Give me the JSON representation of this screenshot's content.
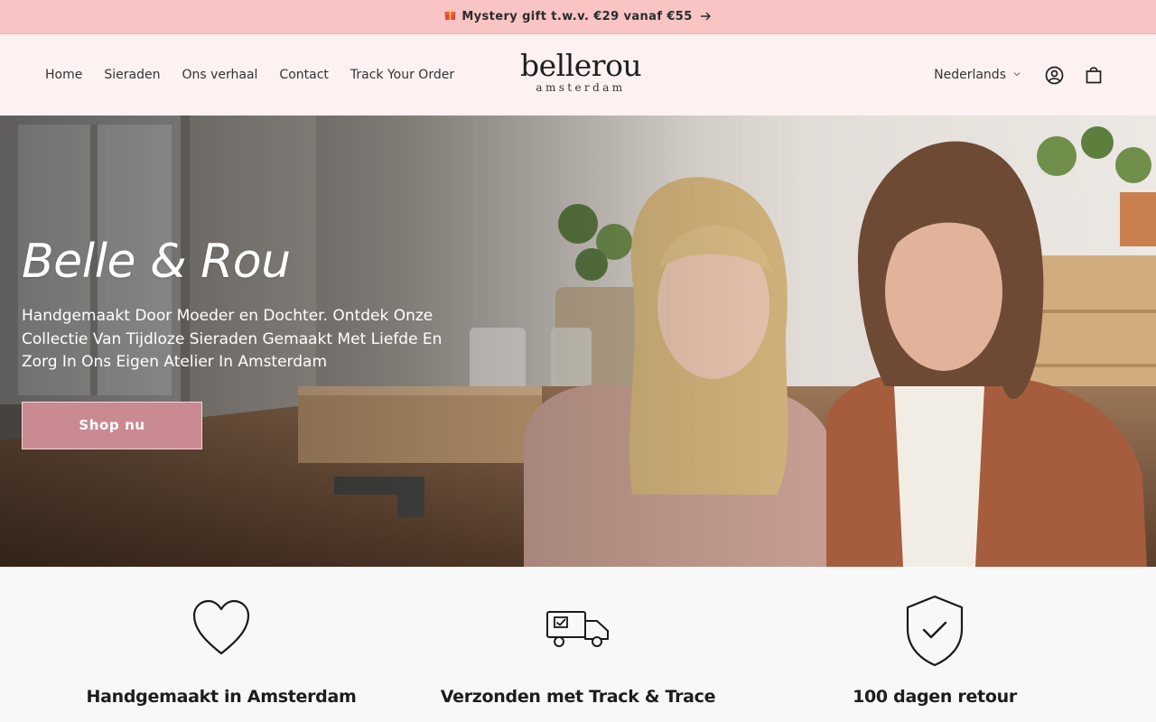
{
  "announcement": {
    "gift_icon": "gift-icon",
    "text": "Mystery gift t.w.v. €29 vanaf €55",
    "arrow_icon": "arrow-right-icon"
  },
  "nav": {
    "items": [
      {
        "label": "Home"
      },
      {
        "label": "Sieraden"
      },
      {
        "label": "Ons verhaal"
      },
      {
        "label": "Contact"
      },
      {
        "label": "Track Your Order"
      }
    ]
  },
  "logo": {
    "word": "bellerou",
    "sub": "amsterdam"
  },
  "header_right": {
    "language": "Nederlands",
    "account_icon": "account-icon",
    "cart_icon": "shopping-bag-icon"
  },
  "hero": {
    "title": "Belle & Rou",
    "description": "Handgemaakt Door Moeder en Dochter. Ontdek Onze Collectie Van Tijdloze Sieraden Gemaakt Met Liefde En Zorg In Ons Eigen Atelier In Amsterdam",
    "button": "Shop nu"
  },
  "features": [
    {
      "icon": "heart-icon",
      "title": "Handgemaakt in Amsterdam"
    },
    {
      "icon": "delivery-truck-icon",
      "title": "Verzonden met Track & Trace"
    },
    {
      "icon": "shield-check-icon",
      "title": "100 dagen retour"
    }
  ],
  "colors": {
    "announcement_bg": "#f8c4c4",
    "header_bg": "#fdf1f1",
    "button_bg": "#c98a92",
    "page_bg": "#f8f8f8"
  }
}
